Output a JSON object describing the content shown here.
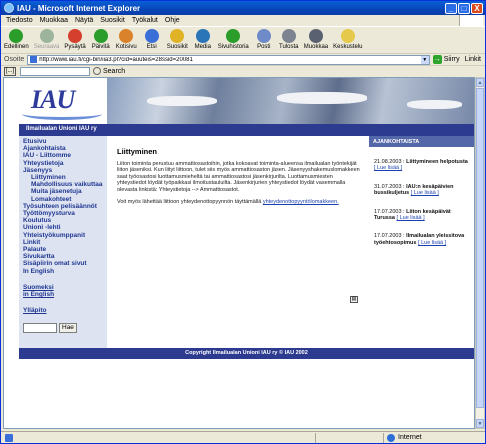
{
  "window": {
    "title": "IAU - Microsoft Internet Explorer",
    "controls": {
      "minimize": "_",
      "maximize": "□",
      "close": "X"
    }
  },
  "menu": [
    "Tiedosto",
    "Muokkaa",
    "Näytä",
    "Suosikit",
    "Työkalut",
    "Ohje"
  ],
  "toolbar": {
    "buttons": [
      {
        "label": "Edellinen",
        "icon": "back-icon",
        "color": "#2a9d2a",
        "enabled": true
      },
      {
        "label": "Seuraava",
        "icon": "forward-icon",
        "color": "#9bb49b",
        "enabled": false
      },
      {
        "label": "Pysäytä",
        "icon": "stop-icon",
        "color": "#d43f2e",
        "enabled": true
      },
      {
        "label": "Päivitä",
        "icon": "refresh-icon",
        "color": "#2a9d2a",
        "enabled": true
      },
      {
        "label": "Kotisivu",
        "icon": "home-icon",
        "color": "#d9822b",
        "enabled": true
      },
      {
        "label": "Etsi",
        "icon": "search-icon",
        "color": "#3a6fd8",
        "enabled": true
      },
      {
        "label": "Suosikit",
        "icon": "star-icon",
        "color": "#e0b326",
        "enabled": true
      },
      {
        "label": "Media",
        "icon": "media-icon",
        "color": "#2a74b8",
        "enabled": true
      },
      {
        "label": "Sivuhistoria",
        "icon": "history-icon",
        "color": "#2a9d2a",
        "enabled": true
      },
      {
        "label": "Posti",
        "icon": "mail-icon",
        "color": "#6e8ac8",
        "enabled": true
      },
      {
        "label": "Tulosta",
        "icon": "print-icon",
        "color": "#7d8390",
        "enabled": true
      },
      {
        "label": "Muokkaa",
        "icon": "edit-icon",
        "color": "#5a6170",
        "enabled": true
      },
      {
        "label": "Keskustelu",
        "icon": "discuss-icon",
        "color": "#e5c94a",
        "enabled": true
      }
    ]
  },
  "address": {
    "label": "Osoite",
    "url": "http://www.iau.fi/cgi-bin/iia3.pl?cid=auuteis=28ssid=20081",
    "go": "Siirry",
    "links": "Linkit"
  },
  "searchbar": {
    "logo": "[...]",
    "button": "Search"
  },
  "site": {
    "logo": "IAU",
    "org_name": "Ilmailualan Unioni IAU ry",
    "nav": [
      {
        "label": "Etusivu",
        "sub": false
      },
      {
        "label": "Ajankohtaista",
        "sub": false
      },
      {
        "label": "IAU - Liittomme",
        "sub": false
      },
      {
        "label": "Yhteystietoja",
        "sub": false
      },
      {
        "label": "Jäsenyys",
        "sub": false
      },
      {
        "label": "Liittyminen",
        "sub": true
      },
      {
        "label": "Mahdollisuus vaikuttaa",
        "sub": true
      },
      {
        "label": "Muita jäsenetuja",
        "sub": true
      },
      {
        "label": "Lomakohteet",
        "sub": true
      },
      {
        "label": "Työsuhteen pelisäännöt",
        "sub": false
      },
      {
        "label": "Työttömyysturva",
        "sub": false
      },
      {
        "label": "Koulutus",
        "sub": false
      },
      {
        "label": "Unioni -lehti",
        "sub": false
      },
      {
        "label": "Yhteistyökumppanit",
        "sub": false
      },
      {
        "label": "Linkit",
        "sub": false
      },
      {
        "label": "Palaute",
        "sub": false
      },
      {
        "label": "Sivukartta",
        "sub": false
      },
      {
        "label": "Sisäpiirin omat sivut",
        "sub": false
      },
      {
        "label": "In English",
        "sub": false
      }
    ],
    "lang_links": [
      "Suomeksi",
      "in English"
    ],
    "admin_link": "Ylläpito",
    "search_button": "Hae",
    "main": {
      "heading": "Liittyminen",
      "paragraph1": "Liiton toiminta perustuu ammattiosastoihin, jotka kokoavat toiminta-alueensa ilmailualan työntekijät liiton jäseniksi. Kun liityt liittoon, tulet siis myös ammattiosaston jäsen. Jäsenyyshakemuslomakkeen saat työosastosi luottamusmieheltä tai ammattiosastosi jäsenkirjurilta. Luottamusmiesten yhteystiedot löydät työpaikkasi ilmoitustauluilta. Jäsenkirjurien yhteystiedot löydät vasemmalla olevasta linkistä: Yhteystietoja --> Ammattiosastot.",
      "paragraph2_text": "Voit myös lähettää liittoon yhteydenottopyynnön täyttämällä",
      "paragraph2_link": "yhteydenottopyyntölomakkeen."
    },
    "news": {
      "heading": "AJANKOHTAISTA",
      "items": [
        {
          "date": "21.08.2003",
          "title": "Liittymineen helpotusta",
          "more": "[ Lue lisää ]"
        },
        {
          "date": "31.07.2003",
          "title": "IAU:n kesäpäivien bussikuljetus",
          "more": "[ Lue lisää ]"
        },
        {
          "date": "17.07.2003",
          "title": "Liiton kesäpäivät Turussa",
          "more": "[ Lue lisää ]"
        },
        {
          "date": "17.07.2003",
          "title": "Ilmailualan yleissitova työehtosopimus",
          "more": "[ Lue lisää ]"
        }
      ]
    },
    "footer": "Copyright Ilmailualan Unioni IAU ry © IAU 2002"
  },
  "status": {
    "zone": "Internet"
  }
}
